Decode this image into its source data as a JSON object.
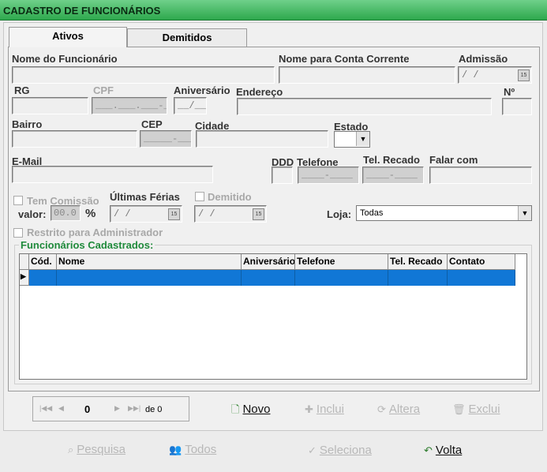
{
  "window": {
    "title": "CADASTRO DE FUNCIONÁRIOS"
  },
  "tabs": [
    {
      "label": "Ativos"
    },
    {
      "label": "Demitidos"
    }
  ],
  "form": {
    "nome_label": "Nome do Funcionário",
    "conta_label": "Nome para Conta Corrente",
    "admissao_label": "Admissão",
    "admissao_value": "/ /",
    "rg_label": "RG",
    "cpf_label": "CPF",
    "cpf_mask": "___.___.___-__",
    "aniversario_label": "Aniversário",
    "aniversario_mask": "__/__",
    "endereco_label": "Endereço",
    "numero_label": "Nº",
    "bairro_label": "Bairro",
    "cep_label": "CEP",
    "cep_mask": "_____-___",
    "cidade_label": "Cidade",
    "estado_label": "Estado",
    "email_label": "E-Mail",
    "ddd_label": "DDD",
    "telefone_label": "Telefone",
    "telefone_mask": "____-____",
    "recado_label": "Tel. Recado",
    "recado_mask": "____-____",
    "falar_label": "Falar com",
    "comissao_label": "Tem Comissão",
    "valor_label": "valor:",
    "valor_value": "00.0",
    "percent": "%",
    "ferias_label": "Últimas Férias",
    "ferias_value": "/ /",
    "demitido_label": "Demitido",
    "demitido_value": "/ /",
    "loja_label": "Loja:",
    "loja_value": "Todas",
    "restrito_label": "Restrito para Administrador",
    "cal_text": "15"
  },
  "grid": {
    "title": "Funcionários Cadastrados:",
    "columns": [
      "Cód.",
      "Nome",
      "Aniversário",
      "Telefone",
      "Tel. Recado",
      "Contato"
    ]
  },
  "nav": {
    "record": "0",
    "de": "de 0"
  },
  "actions": {
    "novo": "Novo",
    "inclui": "Inclui",
    "altera": "Altera",
    "exclui": "Exclui",
    "pesquisa": "Pesquisa",
    "todos": "Todos",
    "seleciona": "Seleciona",
    "volta": "Volta"
  }
}
